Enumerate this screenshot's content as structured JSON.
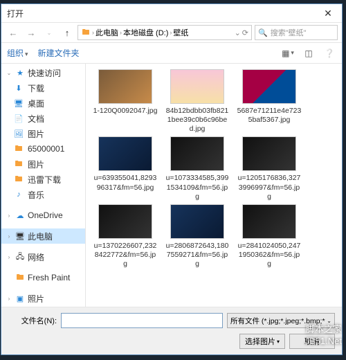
{
  "title": "打开",
  "breadcrumb": [
    "此电脑",
    "本地磁盘 (D:)",
    "壁纸"
  ],
  "search_placeholder": "搜索\"壁纸\"",
  "toolbar": {
    "organize": "组织",
    "new_folder": "新建文件夹"
  },
  "sidebar": {
    "quick_access": "快速访问",
    "items": [
      {
        "icon": "download-icon",
        "color": "ic-blue",
        "label": "下载"
      },
      {
        "icon": "desktop-icon",
        "color": "ic-blue",
        "label": "桌面"
      },
      {
        "icon": "documents-icon",
        "color": "ic-blue",
        "label": "文档"
      },
      {
        "icon": "pictures-icon",
        "color": "ic-blue",
        "label": "图片"
      },
      {
        "icon": "folder-icon",
        "color": "ic-orange",
        "label": "65000001"
      },
      {
        "icon": "folder-icon",
        "color": "ic-orange",
        "label": "图片"
      },
      {
        "icon": "folder-icon",
        "color": "ic-orange",
        "label": "迅雷下载"
      },
      {
        "icon": "music-icon",
        "color": "ic-blue",
        "label": "音乐"
      }
    ],
    "onedrive": "OneDrive",
    "thispc": "此电脑",
    "network": "网络",
    "freshpaint": "Fresh Paint",
    "photos": "照片"
  },
  "files": [
    {
      "name": "1-120Q0092047.jpg",
      "style": "city"
    },
    {
      "name": "84b12bdbb03fb8211bee39c0b6c96bed.jpg",
      "style": "pink"
    },
    {
      "name": "5687e71211e4e7235baf5367.jpg",
      "style": "fcb"
    },
    {
      "name": "u=639355041,829396317&fm=56.jpg",
      "style": "blue"
    },
    {
      "name": "u=1073334585,3991534109&fm=56.jpg",
      "style": "dark"
    },
    {
      "name": "u=1205176836,3273996997&fm=56.jpg",
      "style": "dark"
    },
    {
      "name": "u=1370226607,2328422772&fm=56.jpg",
      "style": "dark"
    },
    {
      "name": "u=2806872643,1807559271&fm=56.jpg",
      "style": "blue"
    },
    {
      "name": "u=2841024050,2471950362&fm=56.jpg",
      "style": "dark"
    }
  ],
  "footer": {
    "filename_label": "文件名(N):",
    "filename_value": "",
    "filter": "所有文件 (*.jpg;*.jpeg;*.bmp;*",
    "open": "选择图片",
    "cancel": "取消"
  },
  "watermark": {
    "line1": "脚本之家",
    "line2": "JB51.Net"
  }
}
